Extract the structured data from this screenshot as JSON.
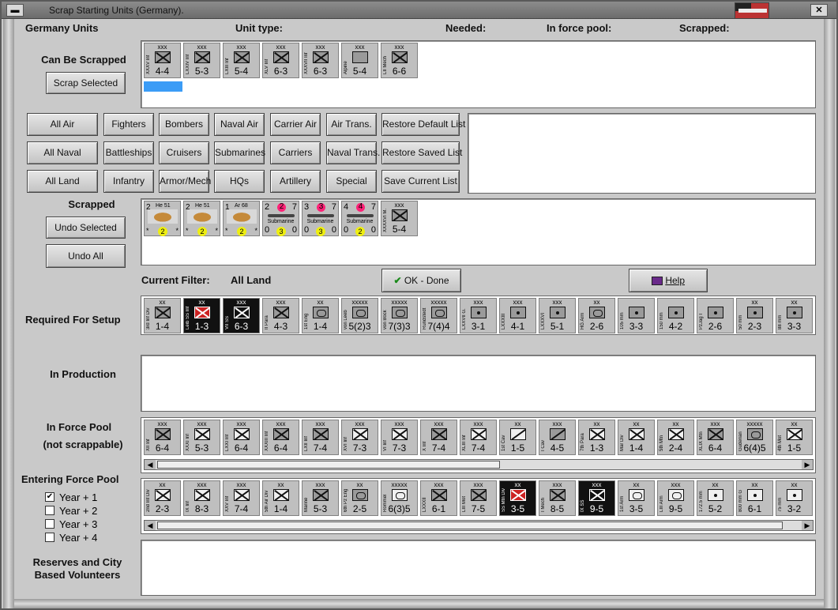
{
  "window": {
    "title": "Scrap Starting Units (Germany)."
  },
  "header": {
    "country_units": "Germany Units",
    "unit_type": "Unit type:",
    "needed": "Needed:",
    "in_force_pool": "In force pool:",
    "scrapped": "Scrapped:"
  },
  "can_be_scrapped": {
    "label": "Can Be Scrapped",
    "button": "Scrap Selected",
    "units": [
      {
        "name": "XXXV Inf",
        "val": "4-4",
        "corps": "xxx",
        "kind": "inf"
      },
      {
        "name": "LXXIV Inf",
        "val": "5-3",
        "corps": "xxx",
        "kind": "inf"
      },
      {
        "name": "LXIII Inf",
        "val": "5-4",
        "corps": "xxx",
        "kind": "inf"
      },
      {
        "name": "XLV Inf",
        "val": "6-3",
        "corps": "xxx",
        "kind": "inf"
      },
      {
        "name": "XXXVII Inf",
        "val": "6-3",
        "corps": "xxx",
        "kind": "inf"
      },
      {
        "name": "Alpine",
        "val": "5-4",
        "corps": "xxx",
        "kind": "mtn"
      },
      {
        "name": "LII Mech",
        "val": "6-6",
        "corps": "xxx",
        "kind": "inf"
      }
    ]
  },
  "filters": {
    "row1": [
      "All Air",
      "Fighters",
      "Bombers",
      "Naval Air",
      "Carrier Air",
      "Air Trans.",
      "Restore Default List"
    ],
    "row2": [
      "All Naval",
      "Battleships",
      "Cruisers",
      "Submarines",
      "Carriers",
      "Naval Trans.",
      "Restore Saved List"
    ],
    "row3": [
      "All Land",
      "Infantry",
      "Armor/Mech",
      "HQs",
      "Artillery",
      "Special",
      "Save Current List"
    ]
  },
  "scrapped": {
    "label": "Scrapped",
    "undo_selected": "Undo Selected",
    "undo_all": "Undo All",
    "air": [
      {
        "n": "2",
        "name": "He 51",
        "dot": "2",
        "left": "*",
        "right": "*"
      },
      {
        "n": "2",
        "name": "He 51",
        "dot": "2",
        "left": "*",
        "right": "*"
      },
      {
        "n": "1",
        "name": "Ar 68",
        "dot": "2",
        "left": "*",
        "right": "*"
      }
    ],
    "subs": [
      {
        "a": "2",
        "b": "7",
        "dot": "3",
        "c": "0",
        "d": "0",
        "name": "Submarine"
      },
      {
        "a": "3",
        "b": "7",
        "dot": "3",
        "c": "0",
        "d": "0",
        "name": "Submarine"
      },
      {
        "a": "4",
        "b": "7",
        "dot": "2",
        "c": "0",
        "d": "0",
        "name": "Submarine"
      }
    ],
    "land": {
      "name": "XXXXVI M.",
      "val": "5-4",
      "corps": "xxx"
    }
  },
  "current_filter": {
    "label": "Current Filter:",
    "value": "All Land"
  },
  "ok_button": "OK - Done",
  "help_button": "Help",
  "required": {
    "label": "Required For Setup",
    "units": [
      {
        "name": "3rd Inf Div",
        "val": "1-4",
        "corps": "xx",
        "kind": "inf"
      },
      {
        "name": "Leib SS Inf",
        "val": "1-3",
        "corps": "xx",
        "kind": "inf",
        "black": true
      },
      {
        "name": "VII SS",
        "val": "6-3",
        "corps": "xxx",
        "kind": "inf",
        "black": true,
        "w": true
      },
      {
        "name": "II Para",
        "val": "4-3",
        "corps": "xxx",
        "kind": "inf"
      },
      {
        "name": "1st Eng",
        "val": "1-4",
        "corps": "xx",
        "kind": "hq"
      },
      {
        "name": "von Leeb",
        "val": "5(2)3",
        "corps": "xxxxx",
        "kind": "hq"
      },
      {
        "name": "von Bock",
        "val": "7(3)3",
        "corps": "xxxxx",
        "kind": "hq"
      },
      {
        "name": "Rundstedt",
        "val": "7(4)4",
        "corps": "xxxxx",
        "kind": "hq"
      },
      {
        "name": "LXXVII G.",
        "val": "3-1",
        "corps": "xxx",
        "kind": "art"
      },
      {
        "name": "LXXXIII Ga.",
        "val": "4-1",
        "corps": "xxx",
        "kind": "art"
      },
      {
        "name": "LXXXVI Ga.",
        "val": "5-1",
        "corps": "xxx",
        "kind": "art"
      },
      {
        "name": "HG Arm Div",
        "val": "2-6",
        "corps": "xx",
        "kind": "hq"
      },
      {
        "name": "105 mm",
        "val": "3-3",
        "corps": "",
        "kind": "art"
      },
      {
        "name": "150 mm",
        "val": "4-2",
        "corps": "",
        "kind": "art"
      },
      {
        "name": "PzJag I",
        "val": "2-6",
        "corps": "",
        "kind": "art"
      },
      {
        "name": "50 mm",
        "val": "2-3",
        "corps": "xx",
        "kind": "art"
      },
      {
        "name": "88 mm",
        "val": "3-3",
        "corps": "xx",
        "kind": "art"
      }
    ]
  },
  "in_production": {
    "label": "In Production"
  },
  "force_pool": {
    "label1": "In Force Pool",
    "label2": "(not scrappable)",
    "units": [
      {
        "name": "XII Inf",
        "val": "6-4",
        "corps": "xxx",
        "kind": "inf"
      },
      {
        "name": "XXXI Inf",
        "val": "5-3",
        "corps": "xxx",
        "kind": "inf",
        "white": true
      },
      {
        "name": "LXXI Inf",
        "val": "6-4",
        "corps": "xxx",
        "kind": "inf",
        "white": true
      },
      {
        "name": "XXXIII Inf",
        "val": "6-4",
        "corps": "xxx",
        "kind": "inf"
      },
      {
        "name": "LXII Inf",
        "val": "7-4",
        "corps": "xxx",
        "kind": "inf"
      },
      {
        "name": "XVI Inf",
        "val": "7-3",
        "corps": "xxx",
        "kind": "inf",
        "white": true
      },
      {
        "name": "VI Inf",
        "val": "7-3",
        "corps": "xxx",
        "kind": "inf",
        "white": true
      },
      {
        "name": "X Inf",
        "val": "7-4",
        "corps": "xxx",
        "kind": "inf"
      },
      {
        "name": "XLIII Inf",
        "val": "7-4",
        "corps": "xxx",
        "kind": "inf",
        "white": true
      },
      {
        "name": "1st Cav Div",
        "val": "1-5",
        "corps": "xx",
        "kind": "cav",
        "white": true
      },
      {
        "name": "I Cav",
        "val": "4-5",
        "corps": "xxx",
        "kind": "cav"
      },
      {
        "name": "7th Para Div",
        "val": "1-3",
        "corps": "xx",
        "kind": "inf",
        "white": true
      },
      {
        "name": "Mar Div",
        "val": "1-4",
        "corps": "xx",
        "kind": "inf",
        "white": true
      },
      {
        "name": "5th Mtn Div",
        "val": "2-4",
        "corps": "xx",
        "kind": "inf",
        "white": true
      },
      {
        "name": "XLIX Mtn",
        "val": "6-4",
        "corps": "xxx",
        "kind": "inf"
      },
      {
        "name": "Guderian",
        "val": "6(4)5",
        "corps": "xxxxx",
        "kind": "hq"
      },
      {
        "name": "4th Mot Div",
        "val": "1-5",
        "corps": "xx",
        "kind": "inf",
        "white": true
      }
    ]
  },
  "entering": {
    "label": "Entering Force Pool",
    "checks": [
      {
        "label": "Year + 1",
        "checked": "✔"
      },
      {
        "label": "Year + 2",
        "checked": ""
      },
      {
        "label": "Year + 3",
        "checked": ""
      },
      {
        "label": "Year + 4",
        "checked": ""
      }
    ],
    "units": [
      {
        "name": "2nd Inf Div",
        "val": "2-3",
        "corps": "xx",
        "kind": "inf",
        "white": true
      },
      {
        "name": "IX Inf",
        "val": "8-3",
        "corps": "xxx",
        "kind": "inf",
        "white": true
      },
      {
        "name": "XXV Inf",
        "val": "7-4",
        "corps": "xxx",
        "kind": "inf",
        "white": true
      },
      {
        "name": "5th Air Div",
        "val": "1-4",
        "corps": "xx",
        "kind": "inf",
        "white": true
      },
      {
        "name": "Marine",
        "val": "5-3",
        "corps": "xxx",
        "kind": "inf"
      },
      {
        "name": "6th Pz Eng",
        "val": "2-5",
        "corps": "xx",
        "kind": "hq"
      },
      {
        "name": "Rommel",
        "val": "6(3)5",
        "corps": "xxxxx",
        "kind": "hq",
        "white": true
      },
      {
        "name": "LXXXII Garr",
        "val": "6-1",
        "corps": "xxx",
        "kind": "inf"
      },
      {
        "name": "LIII Mot",
        "val": "7-5",
        "corps": "xxx",
        "kind": "inf"
      },
      {
        "name": "SS Mtn Div",
        "val": "3-5",
        "corps": "xx",
        "kind": "inf",
        "black": true
      },
      {
        "name": "I Mech",
        "val": "8-5",
        "corps": "xxx",
        "kind": "inf"
      },
      {
        "name": "IX SS Mech",
        "val": "9-5",
        "corps": "xxx",
        "kind": "inf",
        "black": true,
        "w": true
      },
      {
        "name": "1st Arm Div",
        "val": "3-5",
        "corps": "xx",
        "kind": "hq",
        "white": true
      },
      {
        "name": "LIII Arm",
        "val": "9-5",
        "corps": "xxx",
        "kind": "hq",
        "white": true
      },
      {
        "name": "172.5 mm",
        "val": "5-2",
        "corps": "xx",
        "kind": "art",
        "white": true
      },
      {
        "name": "800 mm G",
        "val": "6-1",
        "corps": "xx",
        "kind": "art",
        "white": true
      },
      {
        "name": "75 mm",
        "val": "3-2",
        "corps": "xx",
        "kind": "art",
        "white": true
      }
    ]
  },
  "reserves": {
    "label1": "Reserves and City",
    "label2": "Based Volunteers"
  }
}
